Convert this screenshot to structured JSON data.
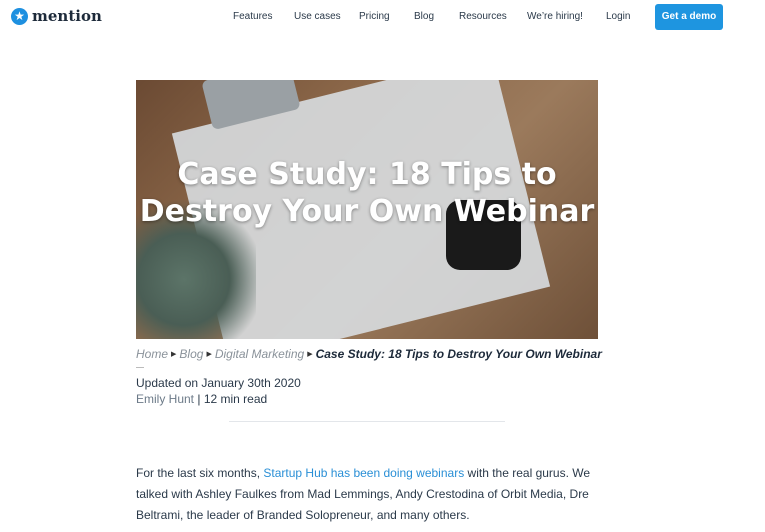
{
  "nav": {
    "logo": "mention",
    "logo_icon": "star-icon",
    "items": [
      "Features",
      "Use cases",
      "Pricing",
      "Blog",
      "Resources",
      "We’re hiring!",
      "Login"
    ],
    "cta": "Get a demo",
    "accent": "#1e95e0"
  },
  "hero": {
    "title": "Case Study: 18 Tips to Destroy Your Own Webinar"
  },
  "breadcrumb": {
    "items": [
      "Home",
      "Blog",
      "Digital Marketing"
    ],
    "current": "Case Study: 18 Tips to Destroy Your Own Webinar"
  },
  "meta": {
    "updated": "Updated on January 30th 2020",
    "author": "Emily Hunt",
    "separator": " | ",
    "read_time": "12 min read"
  },
  "body": {
    "p1_before": "For the last six months, ",
    "p1_link": "Startup Hub has been doing webinars",
    "p1_after": " with the real gurus. We talked with Ashley Faulkes from Mad Lemmings, Andy Crestodina of Orbit Media, Dre Beltrami, the leader of Branded Solopreneur, and many others."
  }
}
